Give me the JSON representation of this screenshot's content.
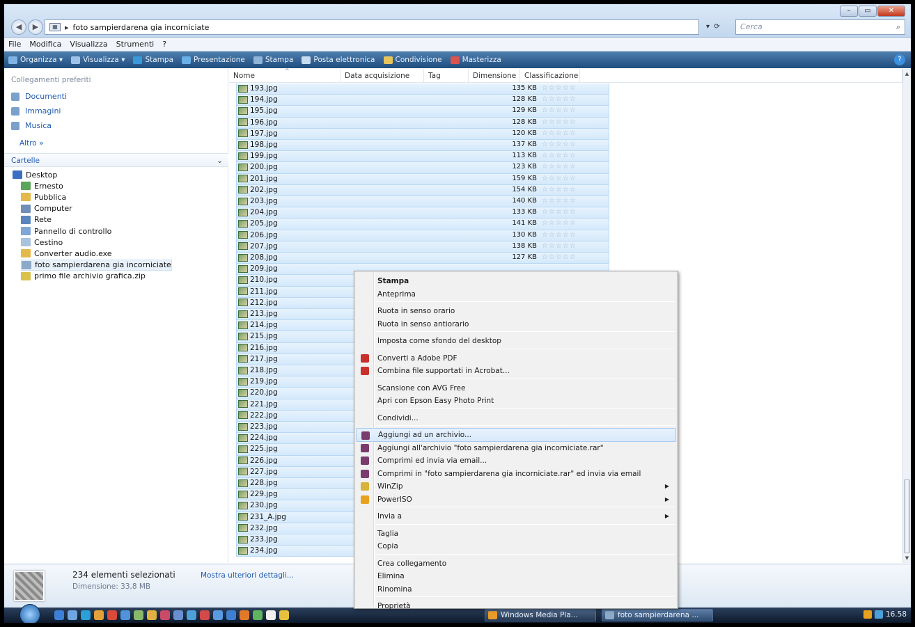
{
  "window": {
    "address_path": "foto sampierdarena gia incorniciate",
    "search_placeholder": "Cerca",
    "controls": {
      "minimize": "–",
      "maximize": "▭",
      "close": "✕"
    }
  },
  "menubar": [
    "File",
    "Modifica",
    "Visualizza",
    "Strumenti",
    "?"
  ],
  "toolbar": [
    {
      "label": "Organizza ▾",
      "icon": "organize-icon",
      "color": "#7fb2e5"
    },
    {
      "label": "Visualizza ▾",
      "icon": "views-icon",
      "color": "#9fc3e8"
    },
    {
      "label": "Stampa",
      "icon": "print-icon",
      "color": "#3a9ad9"
    },
    {
      "label": "Presentazione",
      "icon": "slideshow-icon",
      "color": "#6ab0e8"
    },
    {
      "label": "Stampa",
      "icon": "printer-icon",
      "color": "#8fb4d6"
    },
    {
      "label": "Posta elettronica",
      "icon": "email-icon",
      "color": "#c6dcf0"
    },
    {
      "label": "Condivisione",
      "icon": "share-icon",
      "color": "#e8c45a"
    },
    {
      "label": "Masterizza",
      "icon": "burn-icon",
      "color": "#d9534f"
    }
  ],
  "nav": {
    "favorites_heading": "Collegamenti preferiti",
    "favorites": [
      {
        "label": "Documenti",
        "icon": "documents-icon"
      },
      {
        "label": "Immagini",
        "icon": "pictures-icon"
      },
      {
        "label": "Musica",
        "icon": "music-icon"
      }
    ],
    "more": "Altro  »",
    "folders_heading": "Cartelle",
    "tree": [
      {
        "label": "Desktop",
        "icon": "desktop-icon",
        "color": "#3b6fc4",
        "indent": 0
      },
      {
        "label": "Ernesto",
        "icon": "user-folder-icon",
        "color": "#5aa55a",
        "indent": 1
      },
      {
        "label": "Pubblica",
        "icon": "folder-icon",
        "color": "#e5b84a",
        "indent": 1
      },
      {
        "label": "Computer",
        "icon": "computer-icon",
        "color": "#6f8fb8",
        "indent": 1
      },
      {
        "label": "Rete",
        "icon": "network-icon",
        "color": "#5b86bd",
        "indent": 1
      },
      {
        "label": "Pannello di controllo",
        "icon": "control-panel-icon",
        "color": "#7fa6d4",
        "indent": 1
      },
      {
        "label": "Cestino",
        "icon": "recycle-bin-icon",
        "color": "#a8c3dd",
        "indent": 1
      },
      {
        "label": "Converter audio.exe",
        "icon": "folder-icon",
        "color": "#e5b84a",
        "indent": 1
      },
      {
        "label": "foto sampierdarena gia incorniciate",
        "icon": "photo-folder-icon",
        "color": "#8da9c8",
        "indent": 1,
        "selected": true
      },
      {
        "label": "primo file archivio grafica.zip",
        "icon": "zip-icon",
        "color": "#d9c14a",
        "indent": 1
      }
    ]
  },
  "columns": [
    "Nome",
    "Data acquisizione",
    "Tag",
    "Dimensione",
    "Classificazione"
  ],
  "files": [
    {
      "name": "193.jpg",
      "size": "135 KB"
    },
    {
      "name": "194.jpg",
      "size": "128 KB"
    },
    {
      "name": "195.jpg",
      "size": "129 KB"
    },
    {
      "name": "196.jpg",
      "size": "128 KB"
    },
    {
      "name": "197.jpg",
      "size": "120 KB"
    },
    {
      "name": "198.jpg",
      "size": "137 KB"
    },
    {
      "name": "199.jpg",
      "size": "113 KB"
    },
    {
      "name": "200.jpg",
      "size": "123 KB"
    },
    {
      "name": "201.jpg",
      "size": "159 KB"
    },
    {
      "name": "202.jpg",
      "size": "154 KB"
    },
    {
      "name": "203.jpg",
      "size": "140 KB"
    },
    {
      "name": "204.jpg",
      "size": "133 KB"
    },
    {
      "name": "205.jpg",
      "size": "141 KB"
    },
    {
      "name": "206.jpg",
      "size": "130 KB"
    },
    {
      "name": "207.jpg",
      "size": "138 KB"
    },
    {
      "name": "208.jpg",
      "size": "127 KB"
    },
    {
      "name": "209.jpg",
      "size": ""
    },
    {
      "name": "210.jpg",
      "size": ""
    },
    {
      "name": "211.jpg",
      "size": ""
    },
    {
      "name": "212.jpg",
      "size": ""
    },
    {
      "name": "213.jpg",
      "size": ""
    },
    {
      "name": "214.jpg",
      "size": ""
    },
    {
      "name": "215.jpg",
      "size": ""
    },
    {
      "name": "216.jpg",
      "size": ""
    },
    {
      "name": "217.jpg",
      "size": ""
    },
    {
      "name": "218.jpg",
      "size": ""
    },
    {
      "name": "219.jpg",
      "size": ""
    },
    {
      "name": "220.jpg",
      "size": ""
    },
    {
      "name": "221.jpg",
      "size": ""
    },
    {
      "name": "222.jpg",
      "size": ""
    },
    {
      "name": "223.jpg",
      "size": ""
    },
    {
      "name": "224.jpg",
      "size": ""
    },
    {
      "name": "225.jpg",
      "size": ""
    },
    {
      "name": "226.jpg",
      "size": ""
    },
    {
      "name": "227.jpg",
      "size": ""
    },
    {
      "name": "228.jpg",
      "size": ""
    },
    {
      "name": "229.jpg",
      "size": ""
    },
    {
      "name": "230.jpg",
      "size": ""
    },
    {
      "name": "231_A.jpg",
      "size": ""
    },
    {
      "name": "232.jpg",
      "size": ""
    },
    {
      "name": "233.jpg",
      "size": ""
    },
    {
      "name": "234.jpg",
      "size": ""
    }
  ],
  "rating_glyph": "☆☆☆☆☆",
  "context_menu": [
    {
      "label": "Stampa",
      "bold": true
    },
    {
      "label": "Anteprima"
    },
    {
      "sep": true
    },
    {
      "label": "Ruota in senso orario"
    },
    {
      "label": "Ruota in senso antiorario"
    },
    {
      "sep": true
    },
    {
      "label": "Imposta come sfondo del desktop"
    },
    {
      "sep": true
    },
    {
      "label": "Converti a Adobe PDF",
      "icon": "pdf-icon",
      "color": "#c9302c"
    },
    {
      "label": "Combina file supportati in Acrobat...",
      "icon": "acrobat-icon",
      "color": "#c9302c"
    },
    {
      "sep": true
    },
    {
      "label": "Scansione con AVG Free"
    },
    {
      "label": "Apri con Epson Easy Photo Print"
    },
    {
      "sep": true
    },
    {
      "label": "Condividi..."
    },
    {
      "sep": true
    },
    {
      "label": "Aggiungi ad un archivio...",
      "icon": "winrar-icon",
      "color": "#7a3b6e",
      "hover": true
    },
    {
      "label": "Aggiungi all'archivio \"foto sampierdarena gia incorniciate.rar\"",
      "icon": "winrar-icon",
      "color": "#7a3b6e"
    },
    {
      "label": "Comprimi ed invia via email...",
      "icon": "winrar-icon",
      "color": "#7a3b6e"
    },
    {
      "label": "Comprimi in \"foto sampierdarena gia incorniciate.rar\" ed invia via email",
      "icon": "winrar-icon",
      "color": "#7a3b6e"
    },
    {
      "label": "WinZip",
      "icon": "winzip-icon",
      "color": "#d9b23a",
      "submenu": true
    },
    {
      "label": "PowerISO",
      "icon": "poweriso-icon",
      "color": "#e8a020",
      "submenu": true
    },
    {
      "sep": true
    },
    {
      "label": "Invia a",
      "submenu": true
    },
    {
      "sep": true
    },
    {
      "label": "Taglia"
    },
    {
      "label": "Copia"
    },
    {
      "sep": true
    },
    {
      "label": "Crea collegamento"
    },
    {
      "label": "Elimina"
    },
    {
      "label": "Rinomina"
    },
    {
      "sep": true
    },
    {
      "label": "Proprietà"
    }
  ],
  "details": {
    "count": "234 elementi selezionati",
    "size": "Dimensione: 33,8 MB",
    "more": "Mostra ulteriori dettagli..."
  },
  "taskbar": {
    "buttons": [
      {
        "label": "Windows Media Pla...",
        "color": "#e89a2a",
        "active": false
      },
      {
        "label": "foto sampierdarena ...",
        "color": "#8da9c8",
        "active": true
      }
    ],
    "clock": "16.58"
  },
  "quicklaunch_colors": [
    "#3d7fd6",
    "#6fa5e0",
    "#2a9fd8",
    "#e2a13a",
    "#d84a3a",
    "#4f93d8",
    "#8ab86a",
    "#e0b040",
    "#c94b6a",
    "#6a8fd0",
    "#4da0d8",
    "#d24a4a",
    "#5a9ae0",
    "#3e7fcf",
    "#e07a2a",
    "#5fb55f",
    "#f0f0f0",
    "#e8c040"
  ]
}
